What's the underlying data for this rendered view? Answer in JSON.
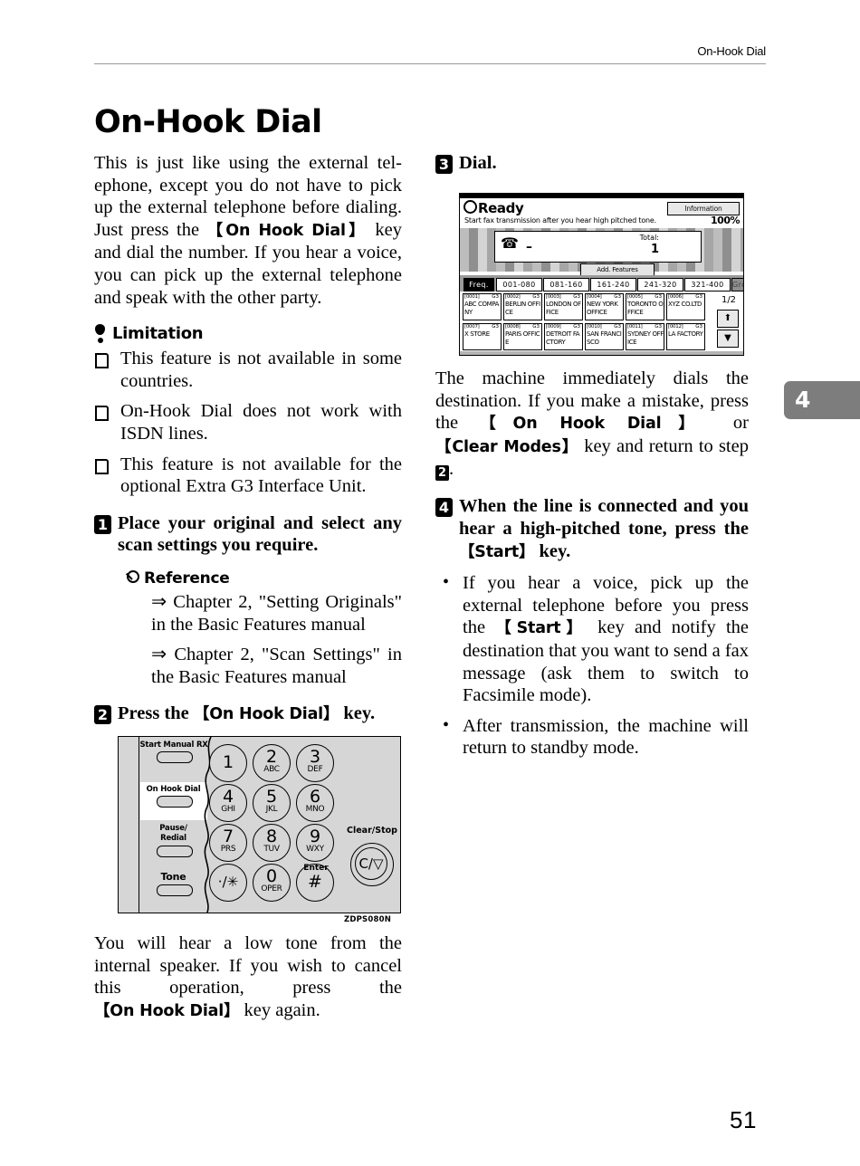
{
  "header": {
    "running_head": "On-Hook Dial"
  },
  "title": "On-Hook Dial",
  "folio": "51",
  "chapter_tab": "4",
  "figure_code": "ZDPS080N",
  "left": {
    "intro_1": "This is just like using the external tel-ephone, except you do not have to pick up the external telephone before dialing. Just press the ",
    "intro_key": "【On Hook Dial】",
    "intro_2": " key and dial the number. If you hear a voice, you can pick up the external telephone and speak with the other party.",
    "limitation_label": "Limitation",
    "limitations": [
      "This feature is not available in some countries.",
      "On-Hook Dial does not work with ISDN lines.",
      "This feature is not available for the optional Extra G3 Interface Unit."
    ],
    "step1_num": "1",
    "step1_text": "Place your original and select any scan settings you require.",
    "reference_label": "Reference",
    "references": [
      "⇒ Chapter 2, \"Setting Originals\" in the Basic Features manual",
      "⇒ Chapter 2, \"Scan Settings\" in the Basic Features manual"
    ],
    "step2_num": "2",
    "step2_pre": "Press the ",
    "step2_key": "【On Hook Dial】",
    "step2_post": " key.",
    "after_fig_1": "You will hear a low tone from the internal speaker. If you wish to cancel this operation, press the ",
    "after_fig_key": "【On Hook Dial】",
    "after_fig_2": " key again."
  },
  "right": {
    "step3_num": "3",
    "step3_text": "Dial.",
    "after_lcd_1": "The machine immediately dials the destination. If you make a mistake, press the ",
    "after_lcd_key1": "【On Hook Dial】",
    "after_lcd_mid": " or ",
    "after_lcd_key2": "【Clear Modes】",
    "after_lcd_2": " key and return to step ",
    "after_lcd_stepref": "2",
    "after_lcd_3": ".",
    "step4_num": "4",
    "step4_pre": "When the line is connected and you hear a high-pitched tone, press the ",
    "step4_key": "【Start】",
    "step4_post": " key.",
    "bullets": [
      {
        "pre": "If you hear a voice, pick up the external telephone before you press the ",
        "key": "【Start】",
        "post": " key and notify the destination that you want to send a fax message (ask them to switch to Facsimile mode)."
      },
      {
        "pre": "After transmission, the machine will return to standby mode.",
        "key": "",
        "post": ""
      }
    ]
  },
  "keypad": {
    "side_buttons": [
      {
        "label": "Start Manual RX",
        "highlight": false
      },
      {
        "label": "On Hook Dial",
        "highlight": true
      },
      {
        "label": "Pause/\nRedial",
        "highlight": false
      },
      {
        "label": "Tone",
        "highlight": false
      }
    ],
    "side_labels": {
      "start_manual_rx": "Start Manual RX",
      "on_hook_dial": "On Hook Dial",
      "pause_redial_1": "Pause/",
      "pause_redial_2": "Redial",
      "tone": "Tone"
    },
    "keys": [
      {
        "big": "1",
        "sub": ""
      },
      {
        "big": "2",
        "sub": "ABC"
      },
      {
        "big": "3",
        "sub": "DEF"
      },
      {
        "big": "4",
        "sub": "GHI"
      },
      {
        "big": "5",
        "sub": "JKL"
      },
      {
        "big": "6",
        "sub": "MNO"
      },
      {
        "big": "7",
        "sub": "PRS"
      },
      {
        "big": "8",
        "sub": "TUV"
      },
      {
        "big": "9",
        "sub": "WXY"
      },
      {
        "big": "·/✳",
        "sub": ""
      },
      {
        "big": "0",
        "sub": "OPER"
      },
      {
        "big": "#",
        "sub": ""
      }
    ],
    "enter_label": "Enter",
    "clear_stop_label": "Clear/Stop",
    "clear_stop_glyph": "C/▽"
  },
  "lcd": {
    "status": "Ready",
    "subtitle": "Start fax transmission after you hear high pitched tone.",
    "information_button": "Information",
    "zoom": "100%",
    "total_label": "Total:",
    "total_value": "1",
    "dial_value": "–",
    "add_features_button": "Add. Features",
    "tabs": [
      {
        "label": "Freq.",
        "state": "selected"
      },
      {
        "label": "001-080",
        "state": "normal"
      },
      {
        "label": "081-160",
        "state": "normal"
      },
      {
        "label": "161-240",
        "state": "normal"
      },
      {
        "label": "241-320",
        "state": "normal"
      },
      {
        "label": "321-400",
        "state": "normal"
      },
      {
        "label": "Group",
        "state": "dim"
      }
    ],
    "page_indicator": "1/2",
    "scroll_up": "⬆",
    "scroll_down": "▼",
    "entries": [
      {
        "id": "[0001]",
        "type": "G3",
        "name": "ABC COMPANY"
      },
      {
        "id": "[0002]",
        "type": "G3",
        "name": "BERLIN OFFICE"
      },
      {
        "id": "[0003]",
        "type": "G3",
        "name": "LONDON OFFICE"
      },
      {
        "id": "[0004]",
        "type": "G3",
        "name": "NEW YORK OFFICE"
      },
      {
        "id": "[0005]",
        "type": "G3",
        "name": "TORONTO OFFICE"
      },
      {
        "id": "[0006]",
        "type": "G3",
        "name": "XYZ CO.LTD"
      },
      {
        "id": "[0007]",
        "type": "G3",
        "name": "X STORE"
      },
      {
        "id": "[0008]",
        "type": "G3",
        "name": "PARIS OFFICE"
      },
      {
        "id": "[0009]",
        "type": "G3",
        "name": "DETROIT FACTORY"
      },
      {
        "id": "[0010]",
        "type": "G3",
        "name": "SAN FRANCISCO"
      },
      {
        "id": "[0011]",
        "type": "G3",
        "name": "SYDNEY OFFICE"
      },
      {
        "id": "[0012]",
        "type": "G3",
        "name": "LA FACTORY"
      }
    ]
  }
}
